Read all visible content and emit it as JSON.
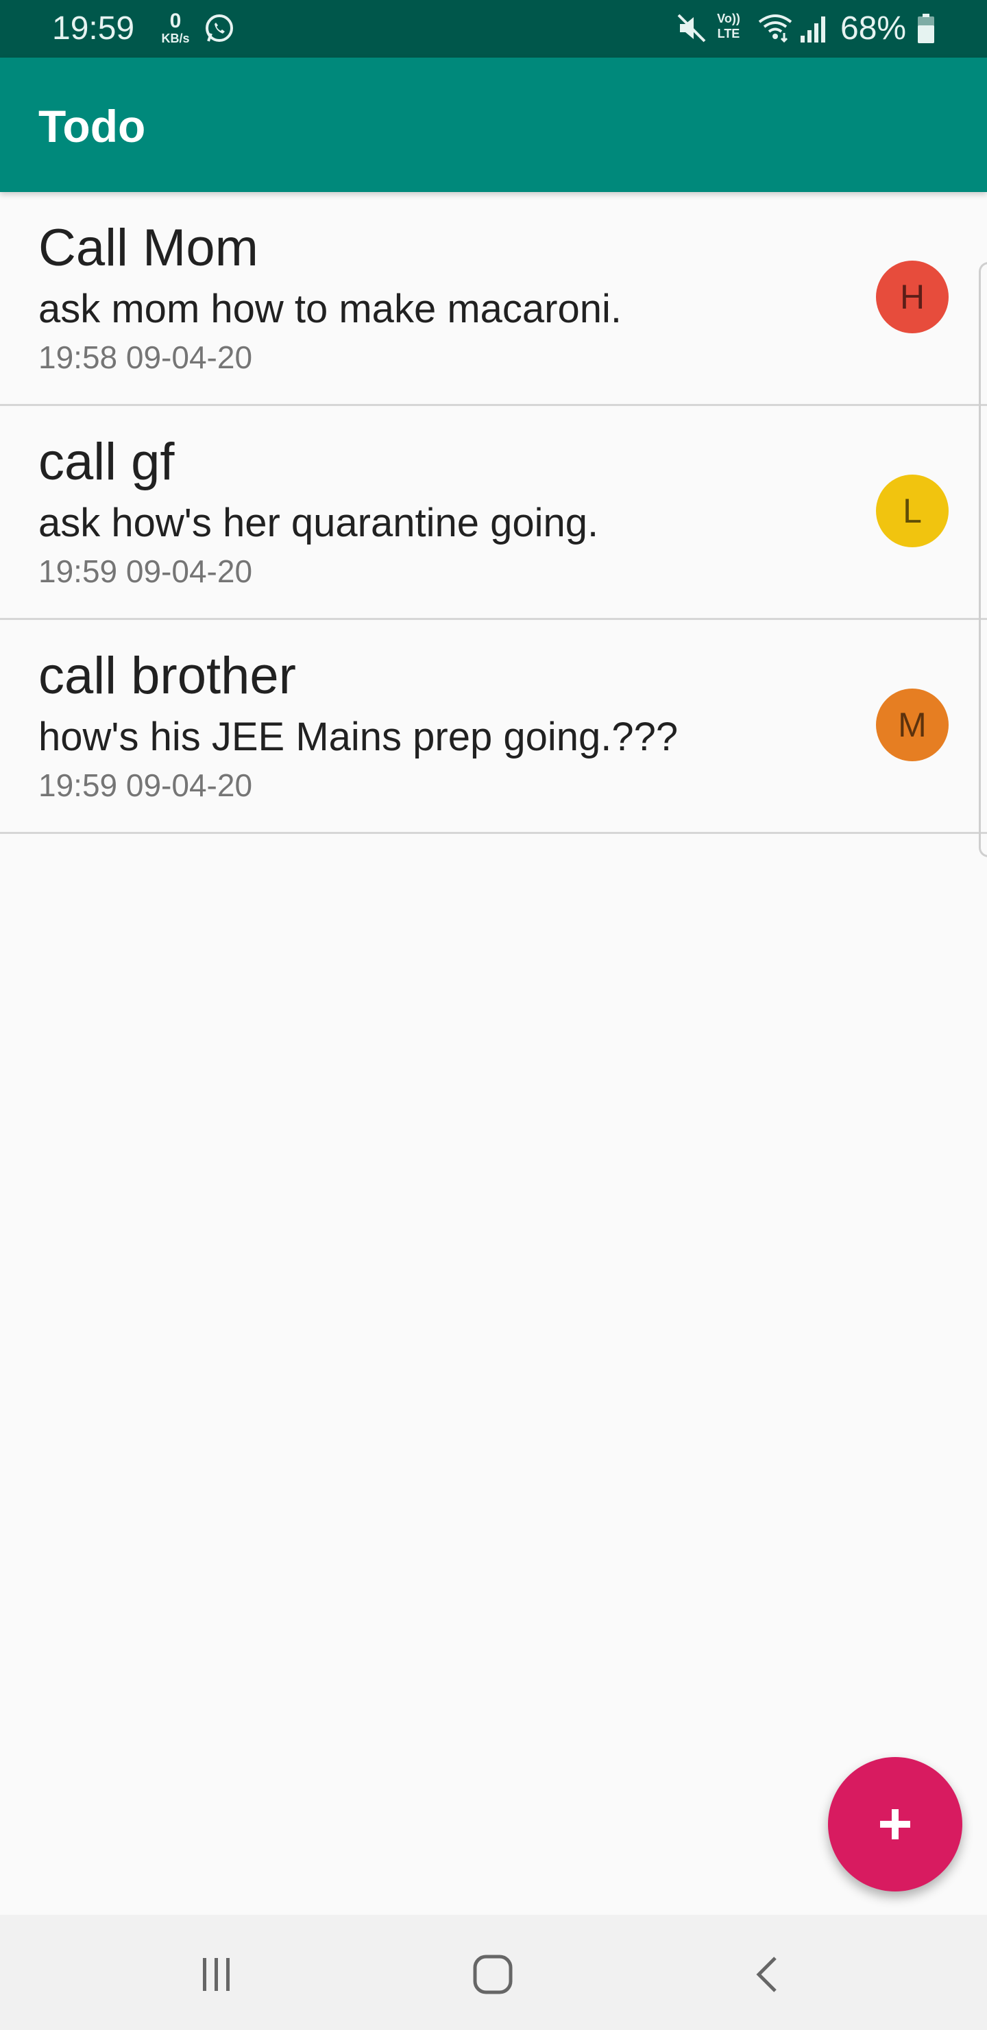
{
  "status_bar": {
    "time": "19:59",
    "net_speed_value": "0",
    "net_speed_unit": "KB/s",
    "volte_top": "Vo))",
    "volte_bottom": "LTE",
    "battery": "68%",
    "icons": [
      "whatsapp-icon",
      "mute-icon",
      "volte-icon",
      "wifi-icon",
      "signal-icon",
      "battery-icon"
    ]
  },
  "app_bar": {
    "title": "Todo"
  },
  "todos": [
    {
      "title": "Call Mom",
      "description": "ask mom how to make macaroni.",
      "timestamp": "19:58 09-04-20",
      "avatar_letter": "H",
      "avatar_color": "#e74c3c"
    },
    {
      "title": "call gf",
      "description": "ask how's her quarantine going.",
      "timestamp": "19:59 09-04-20",
      "avatar_letter": "L",
      "avatar_color": "#f1c40f"
    },
    {
      "title": "call brother",
      "description": "how's his JEE Mains prep going.???",
      "timestamp": "19:59 09-04-20",
      "avatar_letter": "M",
      "avatar_color": "#e67e22"
    }
  ],
  "fab": {
    "icon": "plus-icon",
    "color": "#d81b60"
  },
  "nav_bar": {
    "buttons": [
      "recent-apps-icon",
      "home-icon",
      "back-icon"
    ]
  },
  "colors": {
    "primary": "#00897b",
    "primary_dark": "#00574b",
    "accent": "#d81b60"
  }
}
